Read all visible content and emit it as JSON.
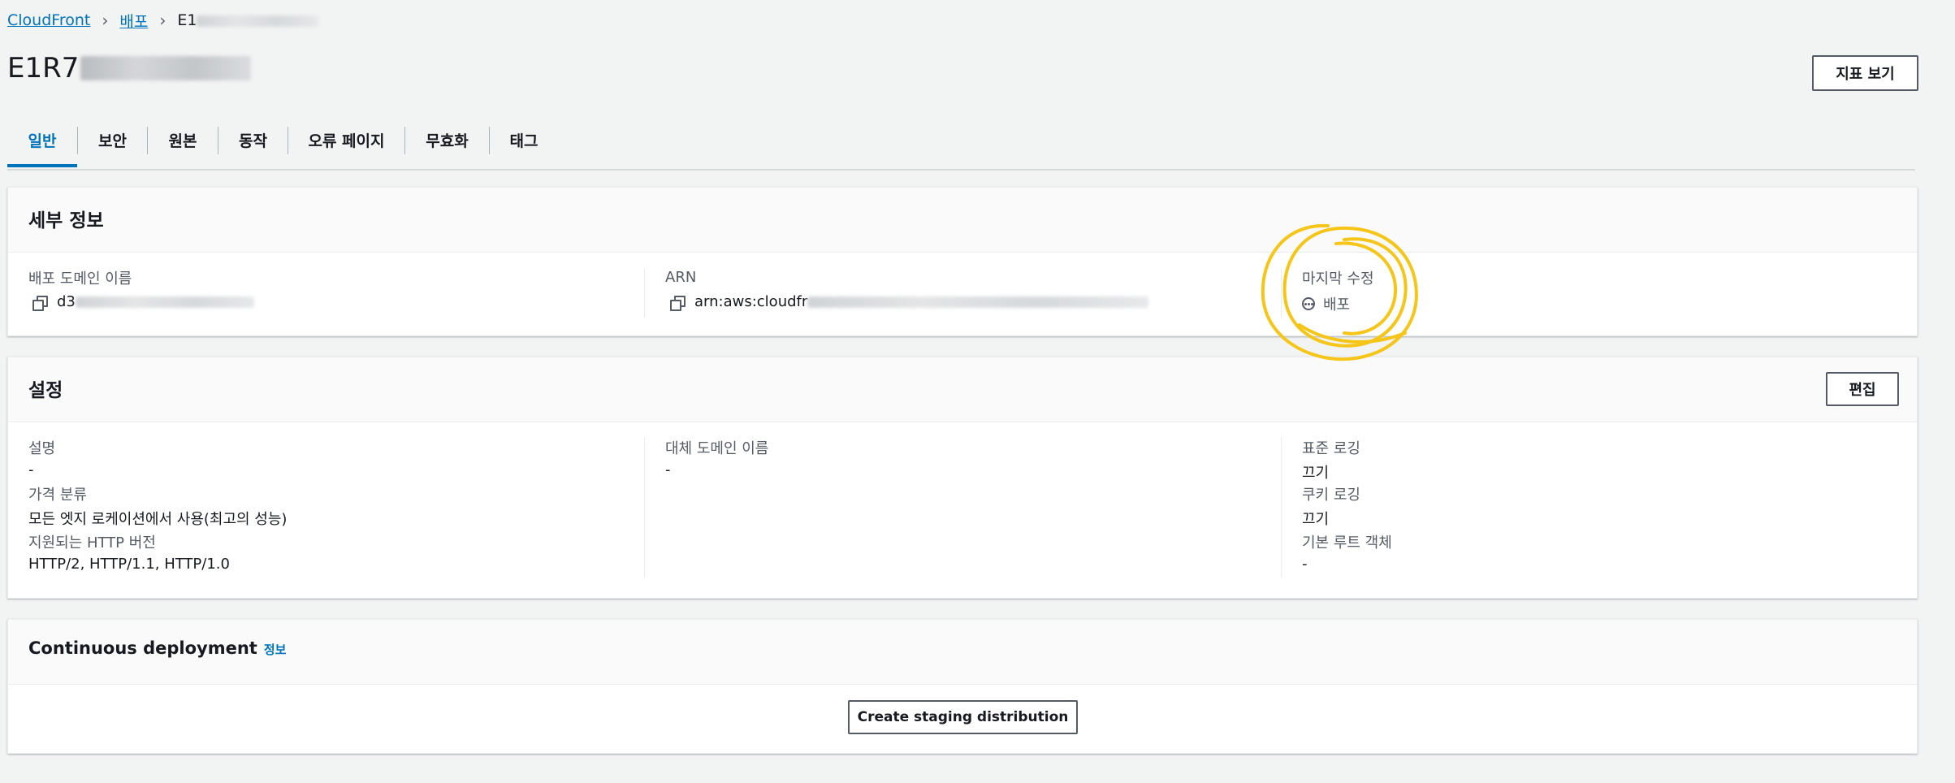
{
  "breadcrumb": {
    "root": "CloudFront",
    "section": "배포",
    "current_prefix": "E1"
  },
  "page": {
    "title_prefix": "E1R7"
  },
  "header_buttons": {
    "metrics": "지표 보기"
  },
  "tabs": [
    "일반",
    "보안",
    "원본",
    "동작",
    "오류 페이지",
    "무효화",
    "태그"
  ],
  "active_tab": "일반",
  "details": {
    "title": "세부 정보",
    "domain_label": "배포 도메인 이름",
    "domain_value_prefix": "d3",
    "arn_label": "ARN",
    "arn_value_prefix": "arn:aws:cloudfr",
    "modified_label": "마지막 수정",
    "modified_value": "배포"
  },
  "settings": {
    "title": "설정",
    "edit_label": "편집",
    "description_label": "설명",
    "description_value": "-",
    "price_class_label": "가격 분류",
    "price_class_value": "모든 엣지 로케이션에서 사용(최고의 성능)",
    "http_label": "지원되는 HTTP 버전",
    "http_value": "HTTP/2, HTTP/1.1, HTTP/1.0",
    "alt_domain_label": "대체 도메인 이름",
    "alt_domain_value": "-",
    "std_logging_label": "표준 로깅",
    "std_logging_value": "끄기",
    "cookie_logging_label": "쿠키 로깅",
    "cookie_logging_value": "끄기",
    "root_object_label": "기본 루트 객체",
    "root_object_value": "-"
  },
  "continuous": {
    "title": "Continuous deployment",
    "info": "정보",
    "staging_button": "Create staging distribution"
  },
  "colors": {
    "link": "#0073bb",
    "background": "#f2f3f3",
    "annotation": "#f5c518"
  },
  "icons": [
    "chevron-right-icon",
    "copy-icon",
    "pending-icon"
  ]
}
